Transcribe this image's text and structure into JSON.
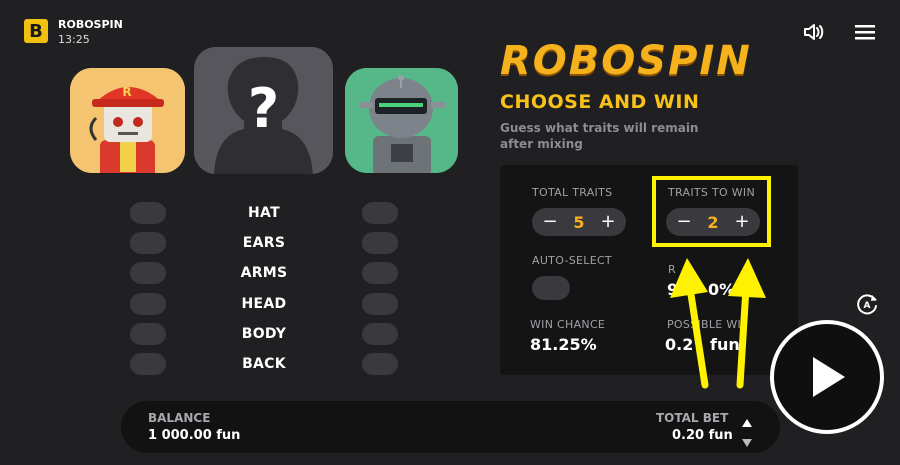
{
  "header": {
    "logo_letter": "B",
    "app_name": "ROBOSPIN",
    "time": "13:25"
  },
  "game": {
    "title": "ROBOSPIN",
    "heading": "CHOOSE AND WIN",
    "subtitle": "Guess what traits will remain after mixing",
    "mystery_symbol": "?",
    "traits": [
      "HAT",
      "EARS",
      "ARMS",
      "HEAD",
      "BODY",
      "BACK"
    ]
  },
  "panel": {
    "total_traits_label": "TOTAL TRAITS",
    "total_traits_value": "5",
    "traits_to_win_label": "TRAITS TO WIN",
    "traits_to_win_value": "2",
    "minus": "−",
    "plus": "+",
    "auto_select_label": "AUTO-SELECT",
    "rtp_label_partial": "R",
    "rtp_value_partial": "9",
    "rtp_value_tail": "0%",
    "win_chance_label": "WIN CHANCE",
    "win_chance_value": "81.25%",
    "possible_win_label": "POSSIBLE WI",
    "possible_win_value": "0.2",
    "possible_win_value_tail": "fun"
  },
  "footer": {
    "balance_label": "BALANCE",
    "balance_value": "1 000.00 fun",
    "total_bet_label": "TOTAL BET",
    "total_bet_value": "0.20 fun"
  },
  "colors": {
    "background": "#202022",
    "accent_yellow": "#f6b21c",
    "highlight": "#fff200",
    "panel": "#141415"
  },
  "icons": [
    "volume-icon",
    "menu-icon",
    "autoplay-icon",
    "play-icon",
    "arrow-up-icon",
    "arrow-down-icon"
  ]
}
